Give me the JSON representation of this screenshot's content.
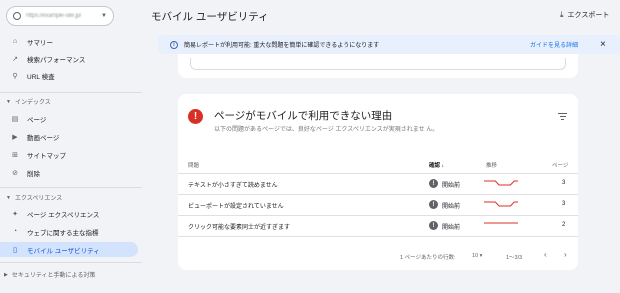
{
  "sidebar": {
    "property_url": "https://example-site.jp/",
    "items_top": [
      {
        "label": "サマリー",
        "icon": "home-icon",
        "glyph": "⌂"
      },
      {
        "label": "検索パフォーマンス",
        "icon": "trending-icon",
        "glyph": "↗"
      },
      {
        "label": "URL 検査",
        "icon": "search-icon",
        "glyph": "⚲"
      }
    ],
    "section_index": "インデックス",
    "items_index": [
      {
        "label": "ページ",
        "icon": "page-icon",
        "glyph": "▤"
      },
      {
        "label": "動画ページ",
        "icon": "video-icon",
        "glyph": "▶"
      },
      {
        "label": "サイトマップ",
        "icon": "sitemap-icon",
        "glyph": "⊞"
      },
      {
        "label": "削除",
        "icon": "remove-icon",
        "glyph": "⊘"
      }
    ],
    "section_experience": "エクスペリエンス",
    "items_experience": [
      {
        "label": "ページ エクスペリエンス",
        "icon": "experience-icon",
        "glyph": "✦"
      },
      {
        "label": "ウェブに関する主な指標",
        "icon": "gauge-icon",
        "glyph": "◔"
      },
      {
        "label": "モバイル ユーザビリティ",
        "icon": "phone-icon",
        "glyph": "▯"
      }
    ],
    "section_security": "セキュリティと手動による対策"
  },
  "header": {
    "title": "モバイル ユーザビリティ",
    "export_label": "エクスポート"
  },
  "banner": {
    "message": "簡易レポートが利用可能: 重大な問題を簡単に確認できるようになります",
    "link_guide": "ガイドを見る",
    "link_detail": "詳細"
  },
  "card": {
    "title": "ページがモバイルで利用できない理由",
    "subtitle": "以下の問題があるページでは、良好なページ エクスペリエンスが実現されませ ん。",
    "columns": {
      "issue": "問題",
      "status": "確認",
      "trend": "推移",
      "pages": "ページ"
    },
    "rows": [
      {
        "reason": "テキストが小さすぎて読めません",
        "status": "開始前",
        "count": "3",
        "trend": [
          2,
          2,
          2,
          2,
          1,
          1,
          1,
          1,
          2,
          2
        ]
      },
      {
        "reason": "ビューポートが設定されていません",
        "status": "開始前",
        "count": "3",
        "trend": [
          2,
          2,
          2,
          2,
          1,
          1,
          1,
          1,
          2,
          2
        ]
      },
      {
        "reason": "クリック可能な要素同士が近すぎます",
        "status": "開始前",
        "count": "2",
        "trend": [
          2,
          2,
          2,
          2,
          2,
          2,
          2,
          2,
          2,
          2
        ]
      }
    ],
    "pager": {
      "rows_label": "1 ページあたりの行数:",
      "rows_value": "10",
      "range": "1〜3/3"
    }
  },
  "colors": {
    "accent": "#0b57d0",
    "error": "#d93025",
    "trend_line": "#d93025",
    "banner_bg": "#e8f0fe"
  }
}
